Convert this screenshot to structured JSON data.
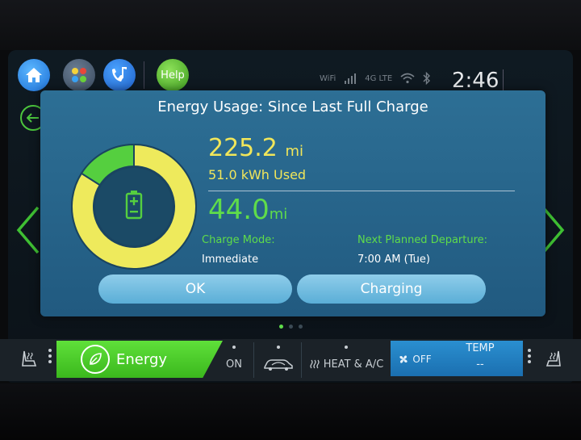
{
  "status_bar": {
    "help_label": "Help",
    "time": "2:46",
    "network_wifi": "WiFi",
    "network_type": "4G LTE"
  },
  "dialog": {
    "title": "Energy Usage: Since Last Full Charge",
    "distance_value": "225.2",
    "distance_unit": "mi",
    "energy_used": "51.0 kWh Used",
    "range_value": "44.0",
    "range_unit": "mi",
    "charge_mode_label": "Charge Mode:",
    "charge_mode_value": "Immediate",
    "departure_label": "Next Planned Departure:",
    "departure_value": "7:00 AM (Tue)",
    "ok_label": "OK",
    "charging_label": "Charging",
    "gauge_green_fraction": 0.16
  },
  "climate_bar": {
    "energy_label": "Energy",
    "on_label": "ON",
    "heat_ac_label": "HEAT & A/C",
    "fan_label": "OFF",
    "temp_label": "TEMP",
    "temp_value": "--"
  },
  "colors": {
    "accent_green": "#5fdc4a",
    "accent_yellow": "#f1e65a",
    "dialog_blue": "#2d6f95",
    "button_blue": "#6bb9df"
  }
}
